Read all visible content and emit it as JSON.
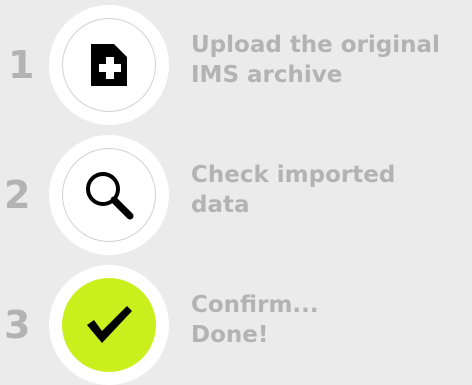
{
  "steps": [
    {
      "number": "1",
      "icon": "add-document-icon",
      "line1": "Upload the original",
      "line2": "IMS archive"
    },
    {
      "number": "2",
      "icon": "magnifier-icon",
      "line1": "Check imported",
      "line2": "data"
    },
    {
      "number": "3",
      "icon": "checkmark-icon",
      "line1": "Confirm...",
      "line2": "Done!"
    }
  ],
  "colors": {
    "background": "#ebebeb",
    "step_text": "#b3b3b3",
    "circle": "#ffffff",
    "done_accent": "#c9f01c",
    "icon": "#000000"
  }
}
